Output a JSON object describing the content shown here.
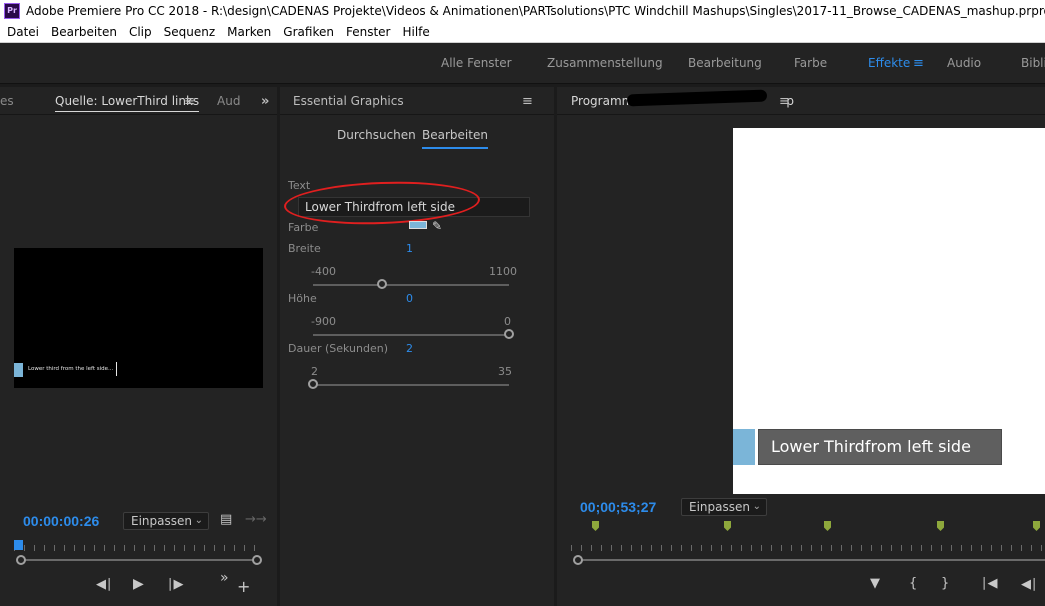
{
  "titlebar": {
    "icon_text": "Pr",
    "title": "Adobe Premiere Pro CC 2018 - R:\\design\\CADENAS Projekte\\Videos & Animationen\\PARTsolutions\\PTC Windchill Mashups\\Singles\\2017-11_Browse_CADENAS_mashup.prproj *"
  },
  "menubar": [
    "Datei",
    "Bearbeiten",
    "Clip",
    "Sequenz",
    "Marken",
    "Grafiken",
    "Fenster",
    "Hilfe"
  ],
  "workspaces": {
    "items": [
      "Alle Fenster",
      "Zusammenstellung",
      "Bearbeitung",
      "Farbe",
      "Effekte",
      "Audio",
      "Biblio"
    ],
    "active": "Effekte"
  },
  "source_panel": {
    "left_tab_fragment": "es",
    "active_tab": "Quelle: LowerThird links",
    "other_tab": "Aud",
    "overflow_icon": "double-chevron-right",
    "preview_caption": "Lower third from the left side...",
    "timecode": "00:00:00:26",
    "fit_dropdown": "Einpassen"
  },
  "essential_graphics": {
    "title": "Essential Graphics",
    "tabs": [
      "Durchsuchen",
      "Bearbeiten"
    ],
    "active_tab": "Bearbeiten",
    "text_label": "Text",
    "text_value": "Lower Thirdfrom left side",
    "color_label": "Farbe",
    "color_value": "#7bb5d8",
    "width": {
      "label": "Breite",
      "value": "1",
      "min": "-400",
      "max": "1100",
      "position": 0.35
    },
    "height": {
      "label": "Höhe",
      "value": "0",
      "min": "-900",
      "max": "0",
      "position": 1.0
    },
    "duration": {
      "label": "Dauer (Sekunden)",
      "value": "2",
      "min": "2",
      "max": "35",
      "position": 0.0
    }
  },
  "program_panel": {
    "title": "Programm: B",
    "title_suffix": "p",
    "lower_third_text": "Lower Thirdfrom left side",
    "timecode": "00;00;53;27",
    "fit_dropdown": "Einpassen"
  },
  "colors": {
    "accent_blue": "#2d8ceb",
    "panel_bg": "#232323",
    "annotation_red": "#e01f1f",
    "marker_green": "#8ea83c"
  }
}
